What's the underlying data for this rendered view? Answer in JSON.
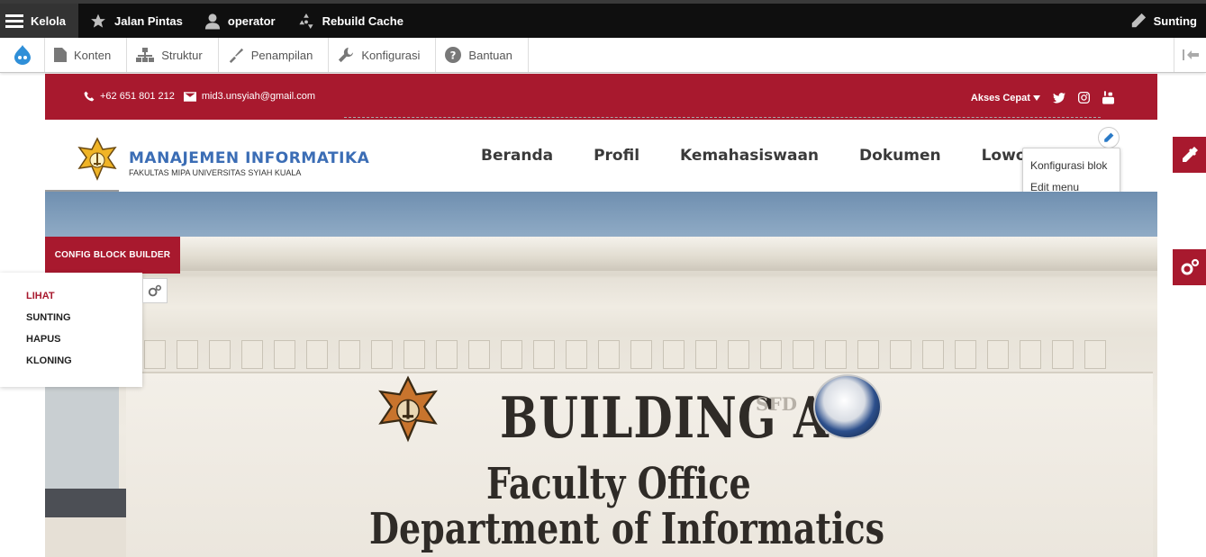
{
  "admin_toolbar": {
    "manage_label": "Kelola",
    "shortcuts_label": "Jalan Pintas",
    "user_label": "operator",
    "rebuild_label": "Rebuild Cache",
    "edit_label": "Sunting"
  },
  "admin_tray": {
    "items": [
      {
        "label": "Konten",
        "icon": "file-icon"
      },
      {
        "label": "Struktur",
        "icon": "sitemap-icon"
      },
      {
        "label": "Penampilan",
        "icon": "paintbrush-icon"
      },
      {
        "label": "Konfigurasi",
        "icon": "wrench-icon"
      },
      {
        "label": "Bantuan",
        "icon": "help-icon"
      }
    ]
  },
  "site": {
    "topbar": {
      "phone": "+62 651 801 212",
      "email": "mid3.unsyiah@gmail.com",
      "quick_access": "Akses Cepat"
    },
    "brand": {
      "title": "MANAJEMEN INFORMATIKA",
      "subtitle": "FAKULTAS MIPA UNIVERSITAS SYIAH KUALA"
    },
    "nav": [
      "Beranda",
      "Profil",
      "Kemahasiswaan",
      "Dokumen",
      "Lowongan Pe"
    ],
    "block_menu": {
      "configure": "Konfigurasi blok",
      "edit_menu": "Edit menu"
    },
    "hero_sign": {
      "line1": "BUILDING A",
      "sfd": "SFD",
      "line2": "Faculty Office",
      "line3": "Department of Informatics"
    }
  },
  "block_builder": {
    "button_label": "CONFIG BLOCK BUILDER",
    "ops": [
      "LIHAT",
      "SUNTING",
      "HAPUS",
      "KLONING"
    ]
  },
  "colors": {
    "brand_red": "#a8192e",
    "toolbar_dark": "#0f0f0f",
    "link_blue": "#2a7ac7"
  }
}
